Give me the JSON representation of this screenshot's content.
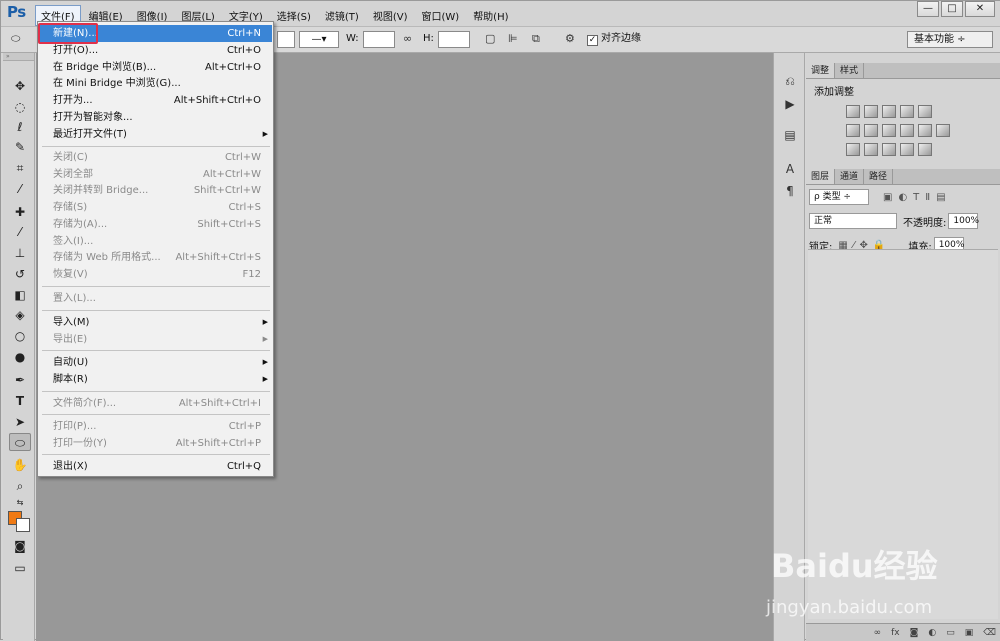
{
  "app": {
    "logo": "Ps"
  },
  "menubar": {
    "items": [
      {
        "label": "文件(F)"
      },
      {
        "label": "编辑(E)"
      },
      {
        "label": "图像(I)"
      },
      {
        "label": "图层(L)"
      },
      {
        "label": "文字(Y)"
      },
      {
        "label": "选择(S)"
      },
      {
        "label": "滤镜(T)"
      },
      {
        "label": "视图(V)"
      },
      {
        "label": "窗口(W)"
      },
      {
        "label": "帮助(H)"
      }
    ]
  },
  "window_buttons": {
    "min": "—",
    "max": "□",
    "close": "✕"
  },
  "options": {
    "w_label": "W:",
    "h_label": "H:",
    "align_edges": "对齐边缘",
    "workspace": "基本功能 ÷"
  },
  "file_menu": {
    "items": [
      {
        "label": "新建(N)...",
        "shortcut": "Ctrl+N"
      },
      {
        "label": "打开(O)...",
        "shortcut": "Ctrl+O"
      },
      {
        "label": "在 Bridge 中浏览(B)...",
        "shortcut": "Alt+Ctrl+O"
      },
      {
        "label": "在 Mini Bridge 中浏览(G)...",
        "shortcut": ""
      },
      {
        "label": "打开为...",
        "shortcut": "Alt+Shift+Ctrl+O"
      },
      {
        "label": "打开为智能对象...",
        "shortcut": ""
      },
      {
        "label": "最近打开文件(T)",
        "shortcut": ""
      },
      {
        "label": "关闭(C)",
        "shortcut": "Ctrl+W"
      },
      {
        "label": "关闭全部",
        "shortcut": "Alt+Ctrl+W"
      },
      {
        "label": "关闭并转到 Bridge...",
        "shortcut": "Shift+Ctrl+W"
      },
      {
        "label": "存储(S)",
        "shortcut": "Ctrl+S"
      },
      {
        "label": "存储为(A)...",
        "shortcut": "Shift+Ctrl+S"
      },
      {
        "label": "签入(I)...",
        "shortcut": ""
      },
      {
        "label": "存储为 Web 所用格式...",
        "shortcut": "Alt+Shift+Ctrl+S"
      },
      {
        "label": "恢复(V)",
        "shortcut": "F12"
      },
      {
        "label": "置入(L)...",
        "shortcut": ""
      },
      {
        "label": "导入(M)",
        "shortcut": ""
      },
      {
        "label": "导出(E)",
        "shortcut": ""
      },
      {
        "label": "自动(U)",
        "shortcut": ""
      },
      {
        "label": "脚本(R)",
        "shortcut": ""
      },
      {
        "label": "文件简介(F)...",
        "shortcut": "Alt+Shift+Ctrl+I"
      },
      {
        "label": "打印(P)...",
        "shortcut": "Ctrl+P"
      },
      {
        "label": "打印一份(Y)",
        "shortcut": "Alt+Shift+Ctrl+P"
      },
      {
        "label": "退出(X)",
        "shortcut": "Ctrl+Q"
      }
    ]
  },
  "adjust_panel": {
    "tabs": [
      "调整",
      "样式"
    ],
    "title": "添加调整"
  },
  "layers_panel": {
    "tabs": [
      "图层",
      "通道",
      "路径"
    ],
    "kind": "ρ 类型 ÷",
    "blend": "正常",
    "opacity_label": "不透明度:",
    "opacity": "100%",
    "lock_label": "锁定:",
    "fill_label": "填充:",
    "fill": "100%"
  },
  "watermark": {
    "brand": "Baidu经验",
    "url": "jingyan.baidu.com"
  },
  "colors": {
    "foreground": "#f07a14",
    "background": "#ffffff",
    "highlight": "#3a85d6"
  }
}
